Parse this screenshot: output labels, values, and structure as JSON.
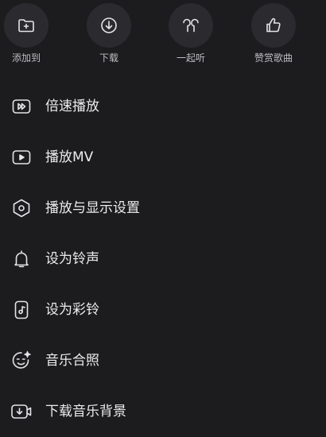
{
  "top_actions": [
    {
      "label": "添加到",
      "icon": "folder-add-icon"
    },
    {
      "label": "下载",
      "icon": "download-icon"
    },
    {
      "label": "一起听",
      "icon": "earbuds-icon"
    },
    {
      "label": "赞赏歌曲",
      "icon": "thumbs-up-icon"
    }
  ],
  "menu": [
    {
      "label": "倍速播放",
      "icon": "speed-play-icon"
    },
    {
      "label": "播放MV",
      "icon": "video-play-icon"
    },
    {
      "label": "播放与显示设置",
      "icon": "hexagon-settings-icon"
    },
    {
      "label": "设为铃声",
      "icon": "bell-icon"
    },
    {
      "label": "设为彩铃",
      "icon": "music-phone-icon"
    },
    {
      "label": "音乐合照",
      "icon": "smiley-sparkle-icon"
    },
    {
      "label": "下载音乐背景",
      "icon": "download-video-icon"
    }
  ],
  "colors": {
    "background": "#1c1c1e",
    "circle": "#2b2b2f",
    "icon": "#e4e4e8",
    "text": "#ececef",
    "label": "#bdbdc2"
  }
}
